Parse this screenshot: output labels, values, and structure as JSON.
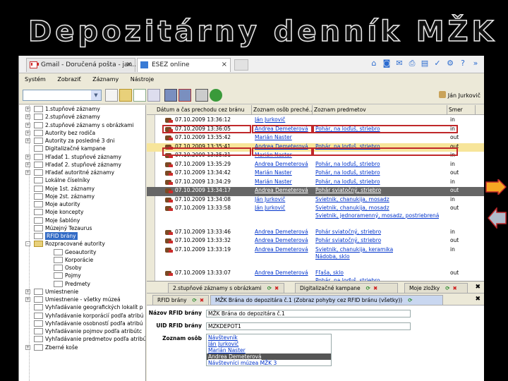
{
  "slide": {
    "title": "Depozitárny denník MŽK"
  },
  "browser": {
    "tabs": [
      {
        "label": "Gmail - Doručená pošta - jan...",
        "close": "×"
      },
      {
        "label": "ESEZ online",
        "close": "×"
      }
    ]
  },
  "menu": [
    "Systém",
    "Zobraziť",
    "Záznamy",
    "Nástroje"
  ],
  "toolbar": {
    "user": "Ján Jurkovič"
  },
  "tree": [
    {
      "label": "1.stupňové záznamy",
      "indent": 0,
      "exp": "+",
      "icon": "doc"
    },
    {
      "label": "2.stupňové záznamy",
      "indent": 0,
      "exp": "+",
      "icon": "doc"
    },
    {
      "label": "2.stupňové záznamy s obrázkami",
      "indent": 0,
      "exp": "+",
      "icon": "doc"
    },
    {
      "label": "Autority bez rodiča",
      "indent": 0,
      "exp": "+",
      "icon": "doc"
    },
    {
      "label": "Autority za posledné 3 dni",
      "indent": 0,
      "exp": "+",
      "icon": "doc"
    },
    {
      "label": "Digitalizačné kampane",
      "indent": 0,
      "exp": "",
      "icon": "doc"
    },
    {
      "label": "Hľadať 1. stupňové záznamy",
      "indent": 0,
      "exp": "+",
      "icon": "doc"
    },
    {
      "label": "Hľadať 2. stupňové záznamy",
      "indent": 0,
      "exp": "+",
      "icon": "doc"
    },
    {
      "label": "Hľadať autoritné záznamy",
      "indent": 0,
      "exp": "+",
      "icon": "doc"
    },
    {
      "label": "Lokálne číselníky",
      "indent": 0,
      "exp": "",
      "icon": "doc"
    },
    {
      "label": "Moje 1st. záznamy",
      "indent": 0,
      "exp": "",
      "icon": "doc"
    },
    {
      "label": "Moje 2st. záznamy",
      "indent": 0,
      "exp": "",
      "icon": "doc"
    },
    {
      "label": "Moje autority",
      "indent": 0,
      "exp": "",
      "icon": "doc"
    },
    {
      "label": "Moje koncepty",
      "indent": 0,
      "exp": "",
      "icon": "doc"
    },
    {
      "label": "Moje šablóny",
      "indent": 0,
      "exp": "",
      "icon": "doc"
    },
    {
      "label": "Múzejný Tezaurus",
      "indent": 0,
      "exp": "",
      "icon": "doc"
    },
    {
      "label": "RFID brány",
      "indent": 0,
      "exp": "",
      "icon": "doc",
      "selected": true
    },
    {
      "label": "Rozpracované autority",
      "indent": 0,
      "exp": "-",
      "icon": "folder"
    },
    {
      "label": "Geoautority",
      "indent": 1,
      "exp": "",
      "icon": "doc"
    },
    {
      "label": "Korporácie",
      "indent": 1,
      "exp": "",
      "icon": "doc"
    },
    {
      "label": "Osoby",
      "indent": 1,
      "exp": "",
      "icon": "doc"
    },
    {
      "label": "Pojmy",
      "indent": 1,
      "exp": "",
      "icon": "doc"
    },
    {
      "label": "Predmety",
      "indent": 1,
      "exp": "",
      "icon": "doc"
    },
    {
      "label": "Umiestnenie",
      "indent": 0,
      "exp": "+",
      "icon": "doc"
    },
    {
      "label": "Umiestnenie - všetky múzeá",
      "indent": 0,
      "exp": "+",
      "icon": "doc"
    },
    {
      "label": "Vyhľadávanie geografických lokalít p",
      "indent": 0,
      "exp": "",
      "icon": "doc"
    },
    {
      "label": "Vyhľadávanie korporácií podľa atribú",
      "indent": 0,
      "exp": "",
      "icon": "doc"
    },
    {
      "label": "Vyhľadávanie osobností podľa atribú",
      "indent": 0,
      "exp": "",
      "icon": "doc"
    },
    {
      "label": "Vyhľadávanie pojmov podľa atribútc",
      "indent": 0,
      "exp": "",
      "icon": "doc"
    },
    {
      "label": "Vyhľadávanie predmetov podľa atribú",
      "indent": 0,
      "exp": "",
      "icon": "doc"
    },
    {
      "label": "Zberné koše",
      "indent": 0,
      "exp": "+",
      "icon": "doc"
    }
  ],
  "grid": {
    "headers": [
      "Dátum a čas prechodu cez bránu",
      "Zoznam osôb preché...",
      "Zoznam predmetov",
      "Smer"
    ],
    "rows": [
      {
        "date": "07.10.2009 13:36:12",
        "person": "Ján Jurkovič",
        "items": [],
        "dir": "in",
        "lines": 1
      },
      {
        "date": "07.10.2009 13:36:05",
        "person": "Andrea Demeterová",
        "items": [
          "Pohár, na loďuš, striebro"
        ],
        "dir": "in",
        "lines": 1
      },
      {
        "date": "07.10.2009 13:35:42",
        "person": "Marián Naster",
        "items": [],
        "dir": "out",
        "lines": 1
      },
      {
        "date": "07.10.2009 13:35:41",
        "person": "Andrea Demeterová",
        "items": [
          "Pohár, na loďuš, striebro"
        ],
        "dir": "out",
        "lines": 1,
        "highlight": true
      },
      {
        "date": "07.10.2009 13:35:31",
        "person": "Marián Naster",
        "items": [],
        "dir": "in",
        "lines": 1
      },
      {
        "date": "07.10.2009 13:35:29",
        "person": "Andrea Demeterová",
        "items": [
          "Pohár, na loďuš, striebro"
        ],
        "dir": "in",
        "lines": 1
      },
      {
        "date": "07.10.2009 13:34:42",
        "person": "Marián Naster",
        "items": [
          "Pohár, na loďuš, striebro"
        ],
        "dir": "out",
        "lines": 1
      },
      {
        "date": "07.10.2009 13:34:29",
        "person": "Marián Naster",
        "items": [
          "Pohár, na loďuš, striebro"
        ],
        "dir": "in",
        "lines": 1
      },
      {
        "date": "07.10.2009 13:34:17",
        "person": "Andrea Demeterová",
        "items": [
          "Pohár sviatočný, striebro"
        ],
        "dir": "out",
        "lines": 1,
        "selected": true
      },
      {
        "date": "07.10.2009 13:34:08",
        "person": "Ján Jurkovič",
        "items": [
          "Svietnik, chanukija, mosadz"
        ],
        "dir": "in",
        "lines": 1
      },
      {
        "date": "07.10.2009 13:33:58",
        "person": "Ján Jurkovič",
        "items": [
          "Svietnik, chanukija, mosadz",
          "Svietnik, jednoramenný, mosadz, postriebrená"
        ],
        "dir": "out",
        "lines": 3
      },
      {
        "date": "07.10.2009 13:33:46",
        "person": "Andrea Demeterová",
        "items": [
          "Pohár sviatočný, striebro"
        ],
        "dir": "in",
        "lines": 1
      },
      {
        "date": "07.10.2009 13:33:32",
        "person": "Andrea Demeterová",
        "items": [
          "Pohár sviatočný, striebro"
        ],
        "dir": "out",
        "lines": 1
      },
      {
        "date": "07.10.2009 13:33:19",
        "person": "Andrea Demeterová",
        "items": [
          "Svietnik, chanukija, keramika",
          "Nádoba, sklo"
        ],
        "dir": "in",
        "lines": 3
      },
      {
        "date": "07.10.2009 13:33:07",
        "person": "Andrea Demeterová",
        "items": [
          "Fľaša, sklo",
          "Pohár, na loďuš, striebro"
        ],
        "dir": "out",
        "lines": 2
      }
    ]
  },
  "tabs_top": [
    {
      "label": "2.stupňové záznamy s obrázkami"
    },
    {
      "label": "Digitalizačné kampane"
    },
    {
      "label": "Moje zložky"
    }
  ],
  "tabs_bottom": [
    {
      "label": "RFID brány"
    },
    {
      "label": "MŽK Brána do depozitára č.1 (Zobraz pohyby cez RFID bránu (všetky))"
    }
  ],
  "detail": {
    "name_label": "Názov RFID brány",
    "name_value": "MŽK Brána do depozitára č.1",
    "uid_label": "UID RFID brány",
    "uid_value": "MZKDEPOT1",
    "persons_label": "Zoznam osôb",
    "persons": [
      "Návštevník",
      "Ján Jurkovič",
      "Marián Naster",
      "Andrea Demeterová",
      "Návštevníci múzea MŽK 3"
    ],
    "persons_selected": 3
  },
  "colors": {
    "red_box": "#c0282a",
    "highlight": "#f7e59a",
    "selected_row": "#666666",
    "link": "#0033cc",
    "next_arrow": "#f5a623",
    "prev_arrow": "#b0bccb"
  }
}
